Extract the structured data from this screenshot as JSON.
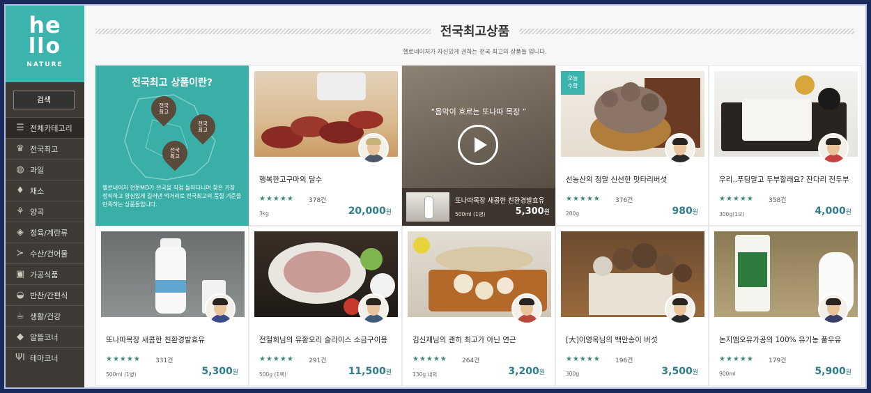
{
  "brand": {
    "word1": "he",
    "word2": "llo",
    "sub": "NATURE"
  },
  "sidebar": {
    "search_label": "검색",
    "items": [
      {
        "label": "전체카테고리",
        "icon": "list-icon"
      },
      {
        "label": "전국최고",
        "icon": "trophy-icon"
      },
      {
        "label": "과일",
        "icon": "apple-icon"
      },
      {
        "label": "채소",
        "icon": "carrot-icon"
      },
      {
        "label": "양곡",
        "icon": "grain-icon"
      },
      {
        "label": "정육/계란류",
        "icon": "meat-icon"
      },
      {
        "label": "수산/건어물",
        "icon": "fish-icon"
      },
      {
        "label": "가공식품",
        "icon": "jar-icon"
      },
      {
        "label": "반찬/간편식",
        "icon": "bowl-icon"
      },
      {
        "label": "생활/건강",
        "icon": "cup-icon"
      },
      {
        "label": "알뜰코너",
        "icon": "tag-icon"
      },
      {
        "label": "테마코너",
        "icon": "utensils-icon"
      }
    ]
  },
  "section": {
    "title": "전국최고상품",
    "subtitle": "헬로네이처가 자신있게 권하는 전국 최고의 상품들 입니다."
  },
  "promo": {
    "title": "전국최고 상품이란?",
    "pins": [
      "전국\n최고",
      "전국\n최고",
      "전국\n최고"
    ],
    "desc": "헬로네이처 전문MD가 전국을 직접 돌아다니며 찾은 가장 정직하고 양심있게 길러낸 먹거리로 전국최고의 품질 기준을 만족하는 상품들입니다."
  },
  "video": {
    "quote": "“음악이 흐르는 또나따 목장 ”",
    "name": "또나따목장 새콤한 친환경발효유",
    "spec": "500ml (1병)",
    "price": "5,300",
    "won": "원"
  },
  "currency": "원",
  "products": [
    {
      "name": "행복한고구마의 달수",
      "stars": "★★★★★",
      "reviews": "378건",
      "spec": "3kg",
      "price": "20,000",
      "img": "sweet-potato"
    },
    {
      "name": "선농산의 정말 신선한 맛타리버섯",
      "stars": "★★★★★",
      "reviews": "376건",
      "spec": "200g",
      "price": "980",
      "badge": "오늘\n수확",
      "img": "mushroom"
    },
    {
      "name": "우리..푸딩말고 두부할래요? 잔다리 전두부",
      "stars": "★★★★★",
      "reviews": "358건",
      "spec": "300g(1모)",
      "price": "4,000",
      "img": "tofu"
    },
    {
      "name": "또나따목장 새콤한 친환경발효유",
      "stars": "★★★★★",
      "reviews": "331건",
      "spec": "500ml (1병)",
      "price": "5,300",
      "img": "milk"
    },
    {
      "name": "전철희님의 유황오리 슬라이스 소금구이용",
      "stars": "★★★★★",
      "reviews": "291건",
      "spec": "500g (1팩)",
      "price": "11,500",
      "img": "duck"
    },
    {
      "name": "김신재님의 괜히 최고가 아닌 연근",
      "stars": "★★★★★",
      "reviews": "264건",
      "spec": "130g 내외",
      "price": "3,200",
      "img": "lotus"
    },
    {
      "name": "[大]이영옥님의 백만송이 버섯",
      "stars": "★★★★★",
      "reviews": "196건",
      "spec": "300g",
      "price": "3,500",
      "img": "beech-mushroom"
    },
    {
      "name": "논지엠오유가공의 100% 유기농 풀우유",
      "stars": "★★★★★",
      "reviews": "179건",
      "spec": "900ml",
      "price": "5,900",
      "img": "organic-milk"
    }
  ]
}
